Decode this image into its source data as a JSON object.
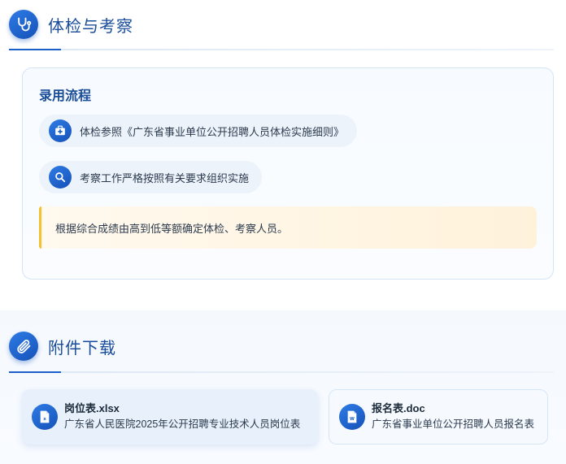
{
  "inspection": {
    "title": "体检与考察",
    "icon": "stethoscope-icon",
    "card": {
      "title": "录用流程",
      "steps": [
        {
          "icon": "medical-kit-icon",
          "text": "体检参照《广东省事业单位公开招聘人员体检实施细则》"
        },
        {
          "icon": "search-icon",
          "text": "考察工作严格按照有关要求组织实施"
        }
      ],
      "notice": "根据综合成绩由高到低等额确定体检、考察人员。"
    }
  },
  "attachments": {
    "title": "附件下载",
    "icon": "paperclip-icon",
    "files": [
      {
        "name": "岗位表.xlsx",
        "description": "广东省人民医院2025年公开招聘专业技术人员岗位表",
        "icon": "excel-file-icon"
      },
      {
        "name": "报名表.doc",
        "description": "广东省事业单位公开招聘人员报名表",
        "icon": "word-file-icon"
      }
    ]
  },
  "colors": {
    "accent": "#1b5fc9",
    "title": "#1a4d99",
    "notice_bar": "#f5c02e",
    "notice_bg": "#fff5e3"
  }
}
